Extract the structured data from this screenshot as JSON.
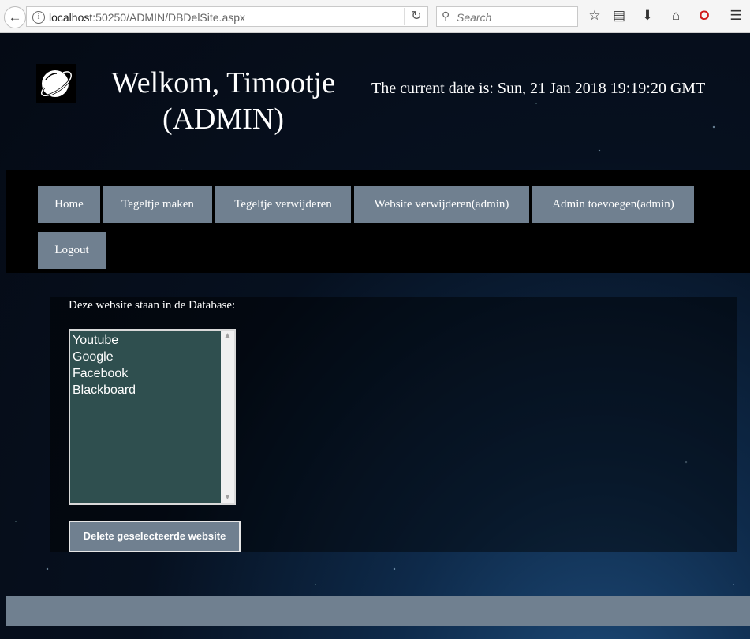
{
  "browser": {
    "url_host": "localhost",
    "url_path": ":50250/ADMIN/DBDelSite.aspx",
    "search_placeholder": "Search",
    "icons": [
      "back-arrow-icon",
      "info-icon",
      "reload-icon",
      "search-icon",
      "star-icon",
      "reading-list-icon",
      "download-icon",
      "home-icon",
      "opera-icon",
      "menu-icon"
    ]
  },
  "header": {
    "welcome_line1": "Welkom, Timootje",
    "welcome_line2": "(ADMIN)",
    "date_text": "The current date is: Sun, 21 Jan 2018 19:19:20 GMT"
  },
  "nav": {
    "items": [
      {
        "label": "Home"
      },
      {
        "label": "Tegeltje maken"
      },
      {
        "label": "Tegeltje verwijderen"
      },
      {
        "label": "Website verwijderen(admin)"
      },
      {
        "label": "Admin toevoegen(admin)"
      },
      {
        "label": "Logout"
      }
    ]
  },
  "main": {
    "caption": "Deze website staan in de Database:",
    "websites": [
      "Youtube",
      "Google",
      "Facebook",
      "Blackboard"
    ],
    "delete_button": "Delete geselecteerde website"
  },
  "colors": {
    "nav_button": "#708090",
    "listbox_bg": "#2f4f4f",
    "footer": "#708090"
  }
}
